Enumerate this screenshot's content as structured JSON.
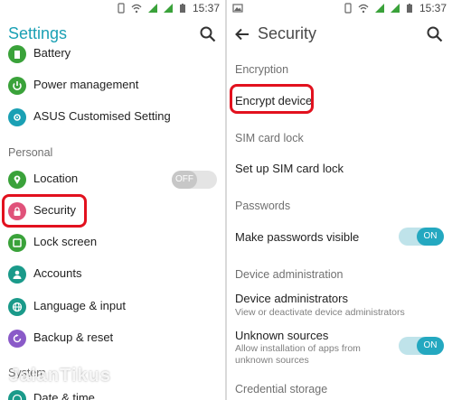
{
  "status_bar": {
    "time_left": "15:37",
    "time_right": "15:37"
  },
  "left": {
    "title": "Settings",
    "items_top": [
      {
        "label": "Battery",
        "icon": "battery-icon",
        "color": "#3aa23a"
      },
      {
        "label": "Power management",
        "icon": "power-management-icon",
        "color": "#3aa23a"
      },
      {
        "label": "ASUS Customised Setting",
        "icon": "asus-customised-icon",
        "color": "#1aa0b4"
      }
    ],
    "section_personal": "Personal",
    "location": {
      "label": "Location",
      "toggle": "OFF",
      "color": "#3aa23a"
    },
    "security": {
      "label": "Security",
      "color": "#e0527a"
    },
    "items_personal": [
      {
        "label": "Lock screen",
        "icon": "lock-screen-icon",
        "color": "#3aa23a"
      },
      {
        "label": "Accounts",
        "icon": "accounts-icon",
        "color": "#1a9a8a"
      },
      {
        "label": "Language & input",
        "icon": "language-icon",
        "color": "#1a9a8a"
      },
      {
        "label": "Backup & reset",
        "icon": "backup-icon",
        "color": "#8a5ac8"
      }
    ],
    "section_system": "System",
    "date_time": "Date & time"
  },
  "right": {
    "title": "Security",
    "encryption_header": "Encryption",
    "encrypt_device": "Encrypt device",
    "sim_header": "SIM card lock",
    "sim_setup": "Set up SIM card lock",
    "passwords_header": "Passwords",
    "make_visible": "Make passwords visible",
    "make_visible_toggle": "ON",
    "device_admin_header": "Device administration",
    "device_admins": "Device administrators",
    "device_admins_sub": "View or deactivate device administrators",
    "unknown_sources": "Unknown sources",
    "unknown_sources_sub": "Allow installation of apps from unknown sources",
    "unknown_sources_toggle": "ON",
    "credential_header": "Credential storage"
  },
  "watermark": "JalanTikus",
  "colors": {
    "accent": "#1aa0b4",
    "highlight": "#e2111e",
    "toggle_on": "#24a8c0"
  }
}
